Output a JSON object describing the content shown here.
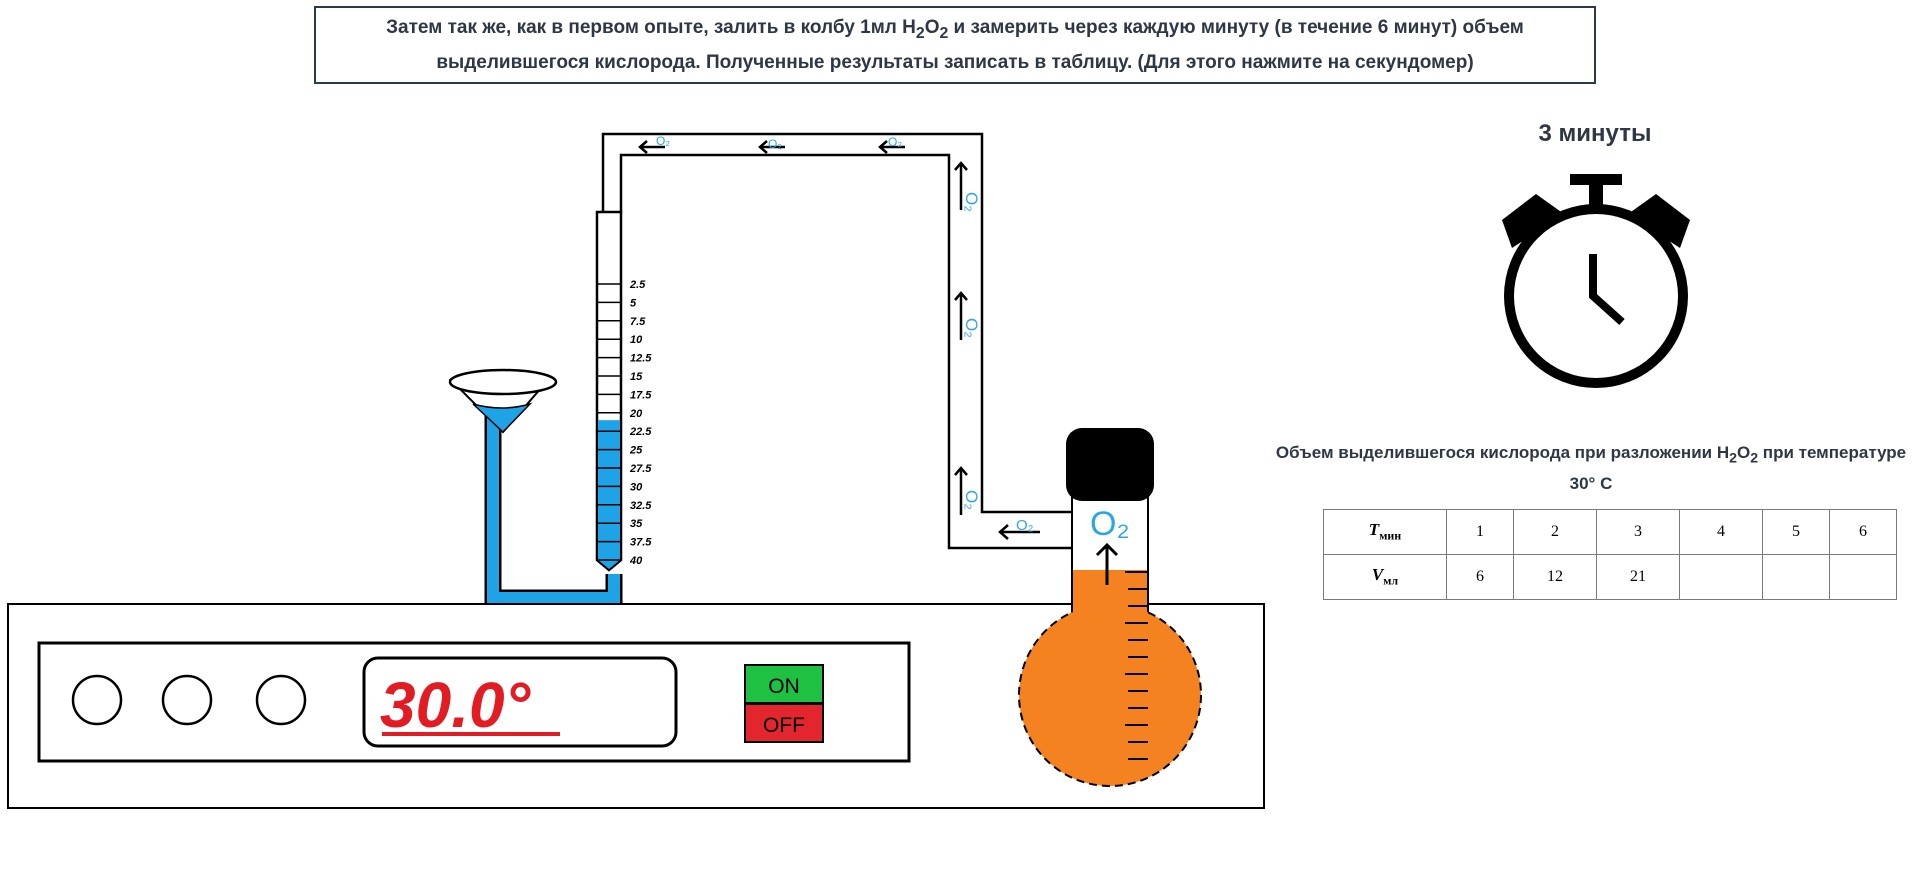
{
  "instruction": {
    "line1_a": "Затем так же, как в первом опыте, залить в колбу 1мл H",
    "line1_sub1": "2",
    "line1_b": "O",
    "line1_sub2": "2",
    "line1_c": " и замерить через каждую минуту (в течение 6 минут) объем",
    "line2": "выделившегося кислорода. Полученные результаты записать в таблицу. (Для этого нажмите на секундомер)"
  },
  "timer": {
    "label": "3 минуты"
  },
  "burette": {
    "gas_label": "O₂",
    "ticks": [
      "2.5",
      "5",
      "7.5",
      "10",
      "12.5",
      "15",
      "17.5",
      "20",
      "22.5",
      "25",
      "27.5",
      "30",
      "32.5",
      "35",
      "37.5",
      "40"
    ],
    "water_level_ml": 21
  },
  "tube": {
    "gas_label": "O₂"
  },
  "flask": {
    "gas_label": "O₂"
  },
  "heater": {
    "temperature": "30.0°",
    "on_label": "ON",
    "off_label": "OFF"
  },
  "colors": {
    "water": "#1ea3e6",
    "flask_liquid": "#f58220",
    "display_red": "#e31b23",
    "on_green": "#1fc142",
    "off_red": "#e3262d",
    "o2_blue": "#2aa8e0"
  },
  "table": {
    "title_a": "Объем выделившегося кислорода при разложении H",
    "title_sub1": "2",
    "title_b": "O",
    "title_sub2": "2",
    "title_c": " при температуре",
    "title_line2": "30° C",
    "row1_label": "T",
    "row1_sub": "мин",
    "row2_label": "V",
    "row2_sub": "мл",
    "minutes": [
      "1",
      "2",
      "3",
      "4",
      "5",
      "6"
    ],
    "volumes": [
      "6",
      "12",
      "21",
      "",
      "",
      ""
    ]
  }
}
